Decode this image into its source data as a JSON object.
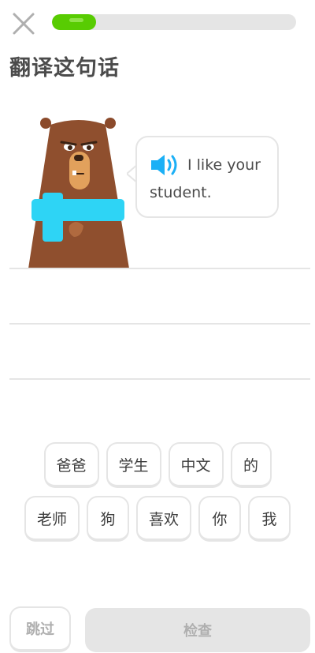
{
  "header": {
    "close_icon": "close-icon",
    "progress": 0.18,
    "progress_color": "#58cc02"
  },
  "prompt": {
    "title": "翻译这句话"
  },
  "bubble": {
    "speaker_icon": "speaker-icon",
    "sentence": "I like your student."
  },
  "word_bank": {
    "row1": [
      "爸爸",
      "学生",
      "中文",
      "的"
    ],
    "row2": [
      "老师",
      "狗",
      "喜欢",
      "你",
      "我"
    ]
  },
  "footer": {
    "skip_label": "跳过",
    "check_label": "检查"
  }
}
